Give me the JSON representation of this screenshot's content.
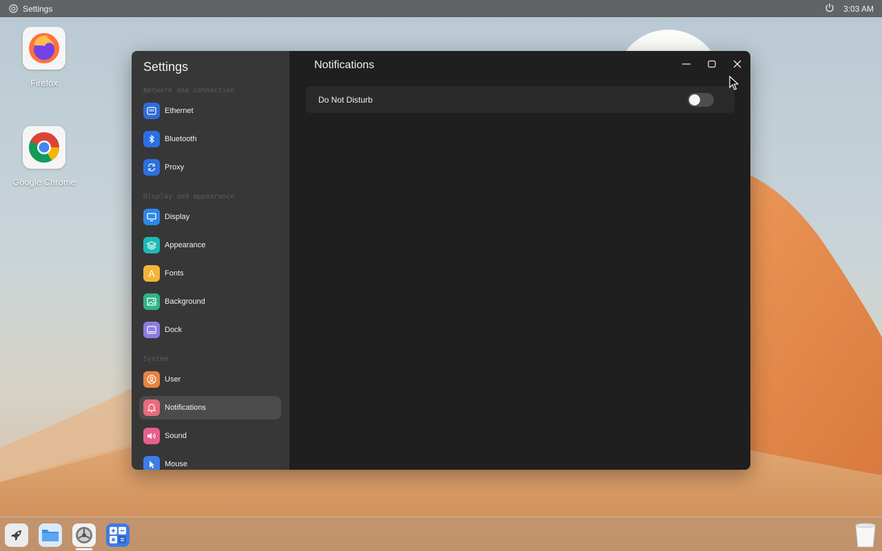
{
  "topbar": {
    "app_title": "Settings",
    "clock": "3:03 AM"
  },
  "desktop": {
    "icons": [
      {
        "label": "Firefox"
      },
      {
        "label": "Google Chrome"
      }
    ]
  },
  "settings": {
    "title": "Settings",
    "page_title": "Notifications",
    "sections": {
      "network": "Network and connection",
      "display": "Display and appearance",
      "system": "System"
    },
    "items": [
      {
        "label": "Ethernet",
        "icon": "ethernet-icon",
        "color": "#2f6bd8"
      },
      {
        "label": "Bluetooth",
        "icon": "bluetooth-icon",
        "color": "#2b6fe6"
      },
      {
        "label": "Proxy",
        "icon": "proxy-icon",
        "color": "#2d6fe0"
      },
      {
        "label": "Display",
        "icon": "display-icon",
        "color": "#2f86e8"
      },
      {
        "label": "Appearance",
        "icon": "appearance-icon",
        "color": "#1fb9b3"
      },
      {
        "label": "Fonts",
        "icon": "fonts-icon",
        "color": "#f3b43b"
      },
      {
        "label": "Background",
        "icon": "background-icon",
        "color": "#2fb48a"
      },
      {
        "label": "Dock",
        "icon": "dock-icon",
        "color": "#8c7be0"
      },
      {
        "label": "User",
        "icon": "user-icon",
        "color": "#e58443"
      },
      {
        "label": "Notifications",
        "icon": "bell-icon",
        "color": "#e86b7d",
        "active": true
      },
      {
        "label": "Sound",
        "icon": "sound-icon",
        "color": "#e75f8f"
      },
      {
        "label": "Mouse",
        "icon": "mouse-icon",
        "color": "#3b7ee8"
      }
    ],
    "dnd": {
      "label": "Do Not Disturb",
      "enabled": false
    }
  },
  "dock": {
    "items": [
      "launcher-icon",
      "files-icon",
      "settings-icon",
      "calculator-icon"
    ],
    "trash": "trash-icon"
  }
}
